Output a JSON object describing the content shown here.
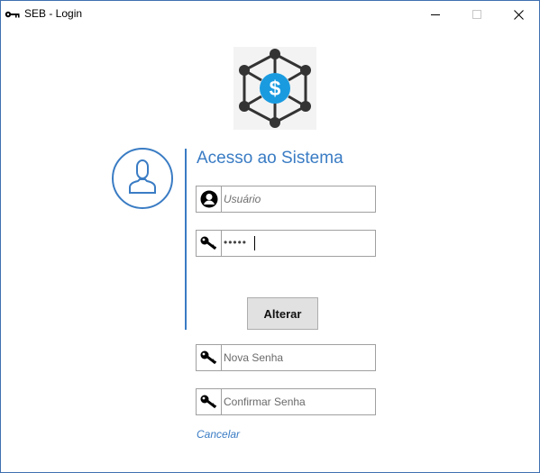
{
  "window": {
    "title": "SEB - Login",
    "icon": "key-icon",
    "controls": [
      "minimize-icon",
      "maximize-icon",
      "close-icon"
    ]
  },
  "logo": {
    "icon": "network-dollar-icon",
    "accent_color": "#1a9be0",
    "node_color": "#333333"
  },
  "avatar": {
    "icon": "user-icon",
    "color": "#3a7cc4"
  },
  "form": {
    "heading": "Acesso ao Sistema",
    "username": {
      "placeholder": "Usuário",
      "value": "",
      "icon": "user-circle-icon"
    },
    "password": {
      "value_mask": "•••••",
      "icon": "key-icon"
    },
    "submit_label": "Alterar",
    "new_password": {
      "placeholder": "Nova Senha",
      "icon": "key-icon"
    },
    "confirm_password": {
      "placeholder": "Confirmar Senha",
      "icon": "key-icon"
    },
    "cancel_label": "Cancelar"
  },
  "colors": {
    "accent": "#3a7cc4",
    "button_bg": "#e1e1e1"
  }
}
